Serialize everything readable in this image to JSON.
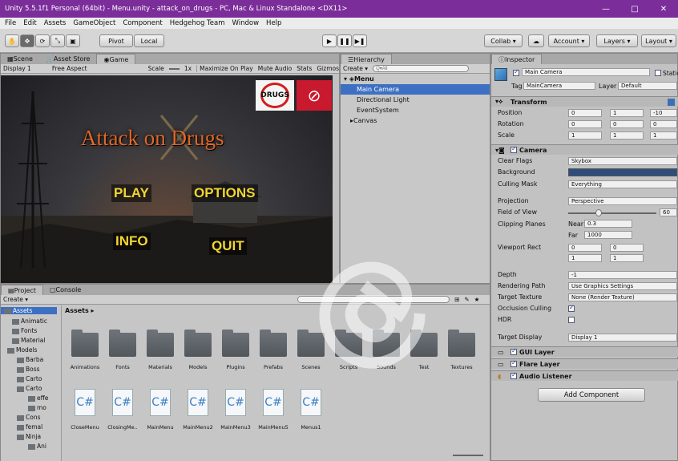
{
  "titlebar": {
    "title": "Unity 5.5.1f1 Personal (64bit) - Menu.unity - attack_on_drugs - PC, Mac & Linux Standalone <DX11>",
    "minimize": "—",
    "restore": "□",
    "close": "✕"
  },
  "menu": [
    "File",
    "Edit",
    "Assets",
    "GameObject",
    "Component",
    "Hedgehog Team",
    "Window",
    "Help"
  ],
  "toolbar": {
    "pivot": "Pivot",
    "local": "Local",
    "collab": "Collab ▾",
    "account": "Account ▾",
    "layers": "Layers ▾",
    "layout": "Layout ▾"
  },
  "scene_tabs": [
    "Scene",
    "Asset Store",
    "Game"
  ],
  "game_bar": {
    "display": "Display 1",
    "aspect": "Free Aspect",
    "scale_label": "Scale",
    "scale_value": "1x",
    "maximize": "Maximize On Play",
    "mute": "Mute Audio",
    "stats": "Stats",
    "gizmos": "Gizmos"
  },
  "game": {
    "logo": "Attack on Drugs",
    "drugs_badge": "DRUGS",
    "play": "PLAY",
    "options": "OPTIONS",
    "info": "INFO",
    "quit": "QUIT"
  },
  "hierarchy": {
    "tab": "Hierarchy",
    "create": "Create ▾",
    "search_placeholder": "Q▾All",
    "scene": "Menu",
    "items": [
      "Main Camera",
      "Directional Light",
      "EventSystem",
      "Canvas"
    ]
  },
  "inspector": {
    "tab": "Inspector",
    "name": "Main Camera",
    "static": "Static",
    "tag_label": "Tag",
    "tag": "MainCamera",
    "layer_label": "Layer",
    "layer": "Default",
    "transform": {
      "title": "Transform",
      "position_label": "Position",
      "position": [
        "0",
        "1",
        "-10"
      ],
      "rotation_label": "Rotation",
      "rotation": [
        "0",
        "0",
        "0"
      ],
      "scale_label": "Scale",
      "scale": [
        "1",
        "1",
        "1"
      ]
    },
    "camera": {
      "title": "Camera",
      "clear_flags_label": "Clear Flags",
      "clear_flags": "Skybox",
      "background_label": "Background",
      "background_color": "#2e4d7a",
      "culling_label": "Culling Mask",
      "culling": "Everything",
      "projection_label": "Projection",
      "projection": "Perspective",
      "fov_label": "Field of View",
      "fov": "60",
      "clipping_label": "Clipping Planes",
      "near_label": "Near",
      "near": "0.3",
      "far_label": "Far",
      "far": "1000",
      "viewport_label": "Viewport Rect",
      "viewport_x": "0",
      "viewport_y": "0",
      "viewport_w": "1",
      "viewport_h": "1",
      "depth_label": "Depth",
      "depth": "-1",
      "rendering_label": "Rendering Path",
      "rendering": "Use Graphics Settings",
      "target_label": "Target Texture",
      "target": "None (Render Texture)",
      "occlusion_label": "Occlusion Culling",
      "hdr_label": "HDR",
      "display_label": "Target Display",
      "display": "Display 1"
    },
    "components": [
      "GUI Layer",
      "Flare Layer",
      "Audio Listener"
    ],
    "add_component": "Add Component"
  },
  "project": {
    "tabs": [
      "Project",
      "Console"
    ],
    "create": "Create ▾",
    "tree": [
      "Assets",
      "Animatic",
      "Fonts",
      "Material",
      "Models",
      "Barba",
      "Boss",
      "Carto",
      "Carto",
      "effe",
      "mo",
      "Cons",
      "femal",
      "Ninja",
      "Ani"
    ],
    "breadcrumb": "Assets ▸",
    "folders": [
      "Animations",
      "Fonts",
      "Materials",
      "Models",
      "Plugins",
      "Prefabs",
      "Scenes",
      "Scripts",
      "Sounds",
      "Test",
      "Textures"
    ],
    "scripts": [
      "CloseMenu",
      "ClosingMe..",
      "MainMenu",
      "MainMenu2",
      "MainMenu3",
      "MainMenu5",
      "Menus1"
    ],
    "script_glyph": "C#"
  }
}
